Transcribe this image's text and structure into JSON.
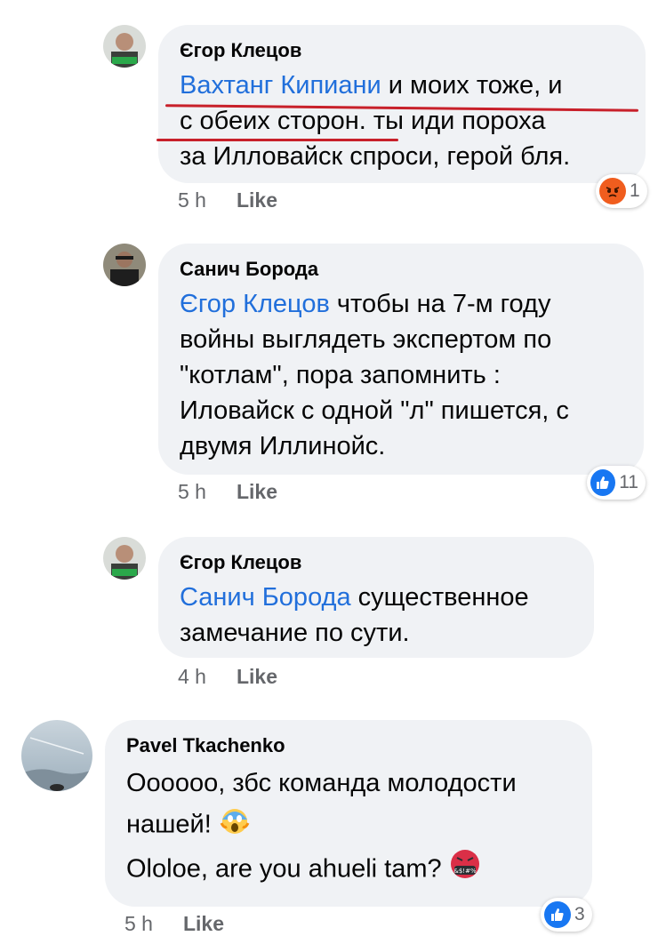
{
  "comments": [
    {
      "author": "Єгор Клецов",
      "mention": "Вахтанг Кипиани",
      "text_line1": " и моих тоже, и",
      "text_line2": "с обеих сторон. ты иди пороха",
      "text_line3": "за Илловайск спроси, герой бля.",
      "time": "5 h",
      "like": "Like",
      "reaction_icon": "angry-icon",
      "reaction_count": "1"
    },
    {
      "author": "Санич Борода",
      "mention": "Єгор Клецов",
      "text_line1": " чтобы на 7-м году",
      "text_line2": "войны выглядеть экспертом по",
      "text_line3": "\"котлам\", пора запомнить :",
      "text_line4": "Иловайск с одной \"л\" пишется, с",
      "text_line5": "двумя Иллинойс.",
      "time": "5 h",
      "like": "Like",
      "reaction_icon": "like-icon",
      "reaction_count": "11"
    },
    {
      "author": "Єгор Клецов",
      "mention": "Санич Борода",
      "text_line1": " существенное",
      "text_line2": "замечание по сути.",
      "time": "4 h",
      "like": "Like"
    },
    {
      "author": "Pavel Tkachenko",
      "text_line1": "Оооооо, збс команда молодости",
      "text_line2": "нашей!",
      "emoji1": "screaming-face-emoji",
      "text_line3": "Ololoe, are you ahueli tam?",
      "emoji2": "swearing-face-emoji",
      "time": "5 h",
      "like": "Like",
      "reaction_icon": "like-icon",
      "reaction_count": "3"
    }
  ],
  "colors": {
    "mention": "#216fdb",
    "bubble": "#f0f2f5",
    "meta": "#65676b",
    "like_blue": "#1877f2",
    "angry_orange": "#f05d1e",
    "annotation_red": "#c8202a"
  }
}
